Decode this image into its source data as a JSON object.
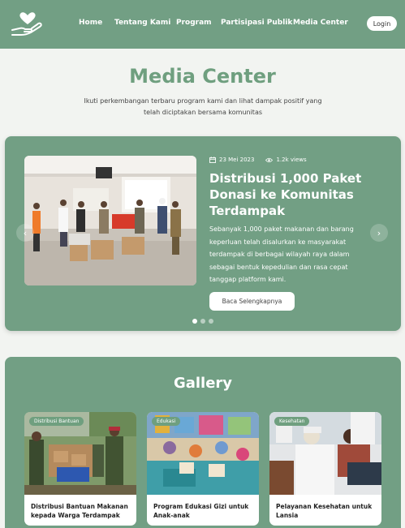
{
  "nav": {
    "links": [
      "Home",
      "Tentang Kami",
      "Program",
      "Partisipasi Publik",
      "Media Center"
    ],
    "login": "Login"
  },
  "hero": {
    "title": "Media Center",
    "subtitle_line1": "Ikuti perkembangan terbaru program kami dan lihat dampak positif yang",
    "subtitle_line2": "telah diciptakan bersama komunitas"
  },
  "featured": {
    "date": "23 Mei 2023",
    "views": "1.2k views",
    "title": "Distribusi 1,000 Paket Donasi ke Komunitas Terdampak",
    "description": "Sebanyak 1,000 paket makanan dan barang keperluan telah disalurkan ke masyarakat terdampak di berbagai wilayah raya dalam sebagai bentuk kepedulian dan rasa cepat tanggap platform kami.",
    "button": "Baca Selengkapnya",
    "slide_count": 3,
    "active_slide": 1
  },
  "gallery": {
    "title": "Gallery",
    "items": [
      {
        "badge": "Distribusi Bantuan",
        "caption": "Distribusi Bantuan Makanan kepada Warga Terdampak"
      },
      {
        "badge": "Edukasi",
        "caption": "Program Edukasi Gizi untuk Anak-anak"
      },
      {
        "badge": "Kesehatan",
        "caption": "Pelayanan Kesehatan untuk Lansia"
      }
    ]
  },
  "colors": {
    "primary": "#729f84",
    "title_green": "#6f9f7f",
    "background": "#f2f4f1"
  }
}
